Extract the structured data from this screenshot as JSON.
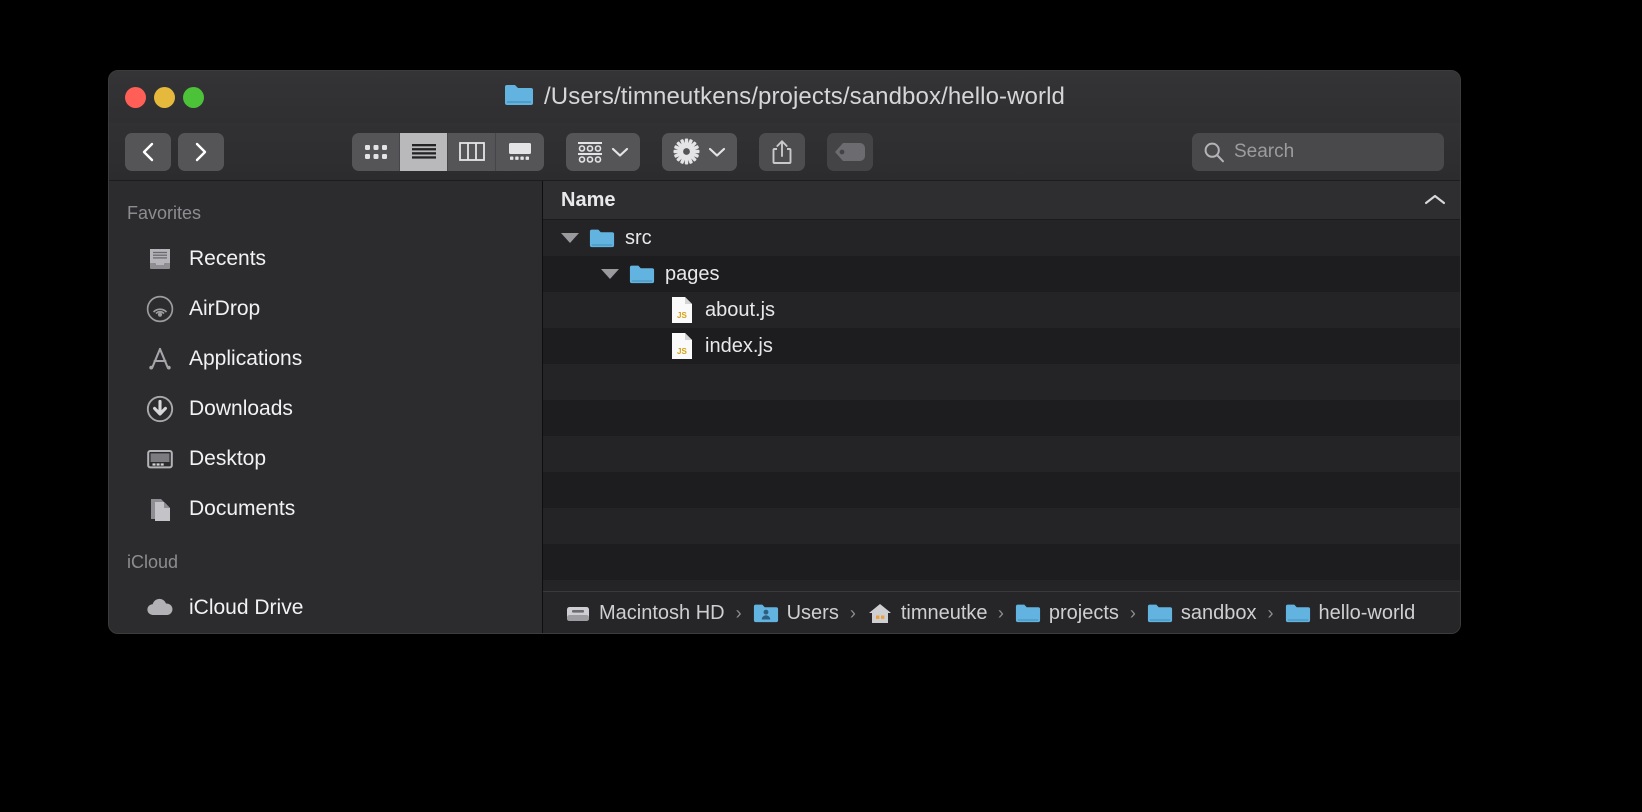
{
  "window": {
    "title": "/Users/timneutkens/projects/sandbox/hello-world",
    "traffic": {
      "close": "close-button",
      "minimize": "minimize-button",
      "maximize": "zoom-button"
    }
  },
  "toolbar": {
    "back_label": "Back",
    "forward_label": "Forward",
    "view_modes": [
      {
        "name": "icon-view",
        "label": "Icon View",
        "active": false
      },
      {
        "name": "list-view",
        "label": "List View",
        "active": true
      },
      {
        "name": "column-view",
        "label": "Column View",
        "active": false
      },
      {
        "name": "gallery-view",
        "label": "Gallery View",
        "active": false
      }
    ],
    "group_label": "Group By",
    "action_label": "Action",
    "share_label": "Share",
    "tags_label": "Tags",
    "search": {
      "placeholder": "Search",
      "value": ""
    }
  },
  "sidebar": {
    "sections": [
      {
        "title": "Favorites",
        "items": [
          {
            "label": "Recents",
            "icon": "recents-icon"
          },
          {
            "label": "AirDrop",
            "icon": "airdrop-icon"
          },
          {
            "label": "Applications",
            "icon": "applications-icon"
          },
          {
            "label": "Downloads",
            "icon": "downloads-icon"
          },
          {
            "label": "Desktop",
            "icon": "desktop-icon"
          },
          {
            "label": "Documents",
            "icon": "documents-icon"
          }
        ]
      },
      {
        "title": "iCloud",
        "items": [
          {
            "label": "iCloud Drive",
            "icon": "icloud-icon"
          }
        ]
      }
    ]
  },
  "filelist": {
    "column_header": "Name",
    "sort_indicator": "chevron-up-icon",
    "rows": [
      {
        "name": "src",
        "icon": "folder-icon",
        "depth": 0,
        "expanded": true,
        "has_disclosure": true
      },
      {
        "name": "pages",
        "icon": "folder-icon",
        "depth": 1,
        "expanded": true,
        "has_disclosure": true
      },
      {
        "name": "about.js",
        "icon": "js-file-icon",
        "depth": 2,
        "expanded": false,
        "has_disclosure": false
      },
      {
        "name": "index.js",
        "icon": "js-file-icon",
        "depth": 2,
        "expanded": false,
        "has_disclosure": false
      }
    ],
    "empty_row_count": 7
  },
  "pathbar": {
    "crumbs": [
      {
        "label": "Macintosh HD",
        "icon": "harddisk-icon",
        "truncated": false
      },
      {
        "label": "Users",
        "icon": "users-folder-icon",
        "truncated": false
      },
      {
        "label": "timneutkens",
        "icon": "home-icon",
        "truncated": true
      },
      {
        "label": "projects",
        "icon": "folder-icon",
        "truncated": true
      },
      {
        "label": "sandbox",
        "icon": "folder-icon",
        "truncated": false
      },
      {
        "label": "hello-world",
        "icon": "folder-icon",
        "truncated": false
      }
    ],
    "separator": "›"
  },
  "colors": {
    "folder_blue": "#63b3e0",
    "window_bg": "#2b2b2d",
    "row_alt": "#1d1d1f",
    "js_yellow": "#d4a017"
  }
}
